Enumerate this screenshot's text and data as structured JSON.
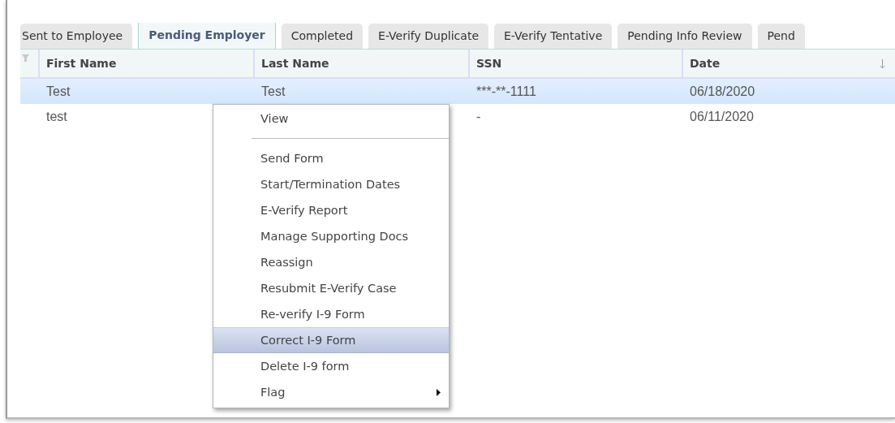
{
  "tabs": [
    {
      "label": "Sent to Employee",
      "selected": false
    },
    {
      "label": "Pending Employer",
      "selected": true
    },
    {
      "label": "Completed",
      "selected": false
    },
    {
      "label": "E-Verify Duplicate",
      "selected": false
    },
    {
      "label": "E-Verify Tentative",
      "selected": false
    },
    {
      "label": "Pending Info Review",
      "selected": false
    },
    {
      "label": "Pend",
      "selected": false
    }
  ],
  "table": {
    "columns": [
      {
        "label": "First Name",
        "sorted": false
      },
      {
        "label": "Last Name",
        "sorted": false
      },
      {
        "label": "SSN",
        "sorted": false
      },
      {
        "label": "Date",
        "sorted": true
      }
    ],
    "rows": [
      {
        "cells": [
          "Test",
          "Test",
          "***-**-1111",
          "06/18/2020"
        ],
        "selected": true
      },
      {
        "cells": [
          "test",
          "",
          "-",
          "06/11/2020"
        ],
        "selected": false
      }
    ]
  },
  "context_menu": {
    "items": [
      {
        "kind": "item",
        "label": "View",
        "selected": false
      },
      {
        "kind": "separator"
      },
      {
        "kind": "item",
        "label": "Send Form",
        "selected": false
      },
      {
        "kind": "item",
        "label": "Start/Termination Dates",
        "selected": false
      },
      {
        "kind": "item",
        "label": "E-Verify Report",
        "selected": false
      },
      {
        "kind": "item",
        "label": "Manage Supporting Docs",
        "selected": false
      },
      {
        "kind": "item",
        "label": "Reassign",
        "selected": false
      },
      {
        "kind": "item",
        "label": "Resubmit E-Verify Case",
        "selected": false
      },
      {
        "kind": "item",
        "label": "Re-verify I-9 Form",
        "selected": false
      },
      {
        "kind": "item",
        "label": "Correct I-9 Form",
        "selected": true
      },
      {
        "kind": "item",
        "label": "Delete I-9 form",
        "selected": false
      },
      {
        "kind": "submenu",
        "label": "Flag",
        "selected": false
      }
    ]
  }
}
